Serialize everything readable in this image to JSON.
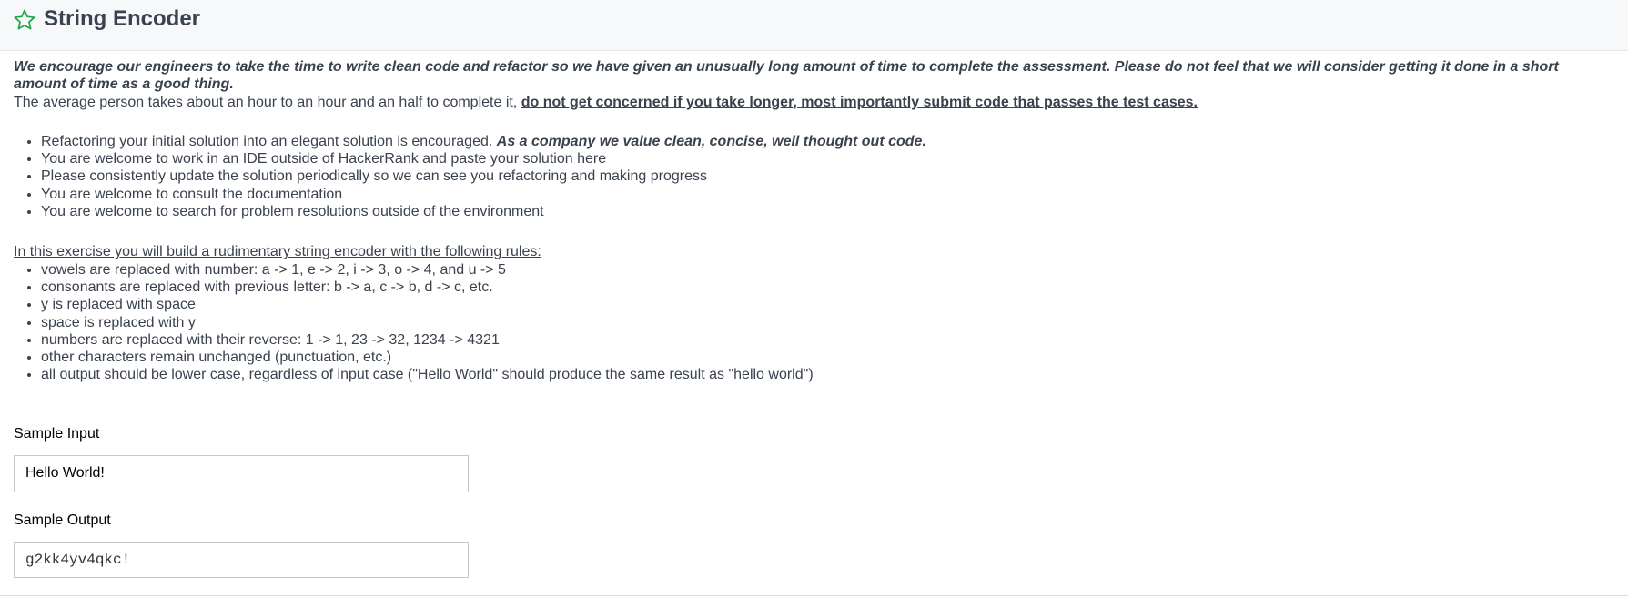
{
  "header": {
    "title": "String Encoder",
    "icon": "star-icon",
    "icon_color": "#1ba94c"
  },
  "intro": {
    "bold_italic": "We encourage our engineers to take the time to write clean code and refactor so we have given an unusually long amount of time to complete the assessment.  Please do not feel that we will consider getting it done in a short amount of time as a good thing.",
    "average_prefix": "The average person takes about an hour to an hour and an half to complete it, ",
    "average_emphasis": "do not get concerned if you take longer, most importantly submit code that passes the test cases."
  },
  "tips": {
    "first_plain": "Refactoring your initial solution into an elegant solution is encouraged. ",
    "first_emphasis": "As a company we value clean, concise, well thought out code.",
    "items": [
      "You are welcome to work in an IDE outside of HackerRank and paste your solution here",
      "Please consistently update the solution periodically so we can see you refactoring and making progress",
      "You are welcome to consult the documentation",
      "You are welcome to search for problem resolutions outside of the environment"
    ]
  },
  "rules": {
    "heading": "In this exercise you will build a rudimentary string encoder with the following rules:",
    "items": [
      "vowels are replaced with number: a -> 1, e -> 2, i -> 3, o -> 4, and u -> 5",
      "consonants are replaced with previous letter: b -> a, c -> b, d -> c, etc.",
      "y is replaced with space",
      "space is replaced with y",
      "numbers are replaced with their reverse: 1 -> 1, 23 -> 32, 1234 -> 4321",
      "other characters remain unchanged (punctuation, etc.)",
      "all output should be lower case, regardless of input case (\"Hello World\" should produce the same result as \"hello world\")"
    ]
  },
  "sample_input": {
    "label": "Sample Input",
    "value": "Hello World!"
  },
  "sample_output": {
    "label": "Sample Output",
    "value": "g2kk4yv4qkc!"
  }
}
